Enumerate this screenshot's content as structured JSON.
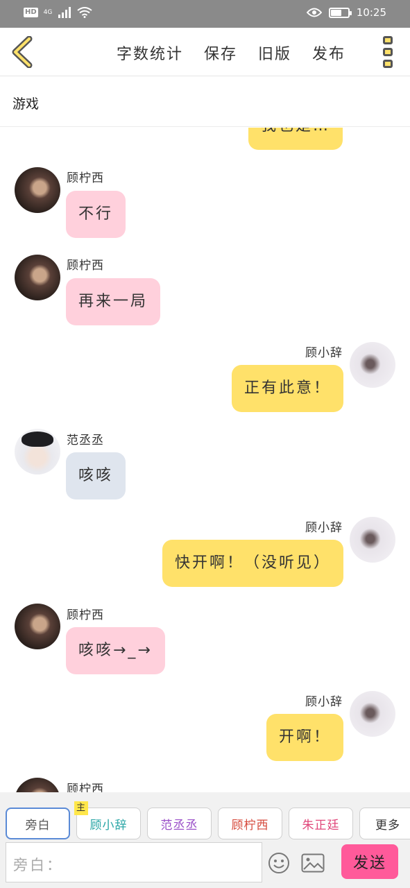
{
  "status_bar": {
    "network_badge": "HD",
    "signal_label": "4G",
    "time": "10:25"
  },
  "toolbar": {
    "actions": [
      "字数统计",
      "保存",
      "旧版",
      "发布"
    ]
  },
  "page": {
    "title": "游戏"
  },
  "messages": [
    {
      "side": "right",
      "speaker": "",
      "text": "我也是…",
      "color": "#ffe16a"
    },
    {
      "side": "left",
      "speaker": "顾柠西",
      "text": "不行",
      "color": "#ffd0dc"
    },
    {
      "side": "left",
      "speaker": "顾柠西",
      "text": "再来一局",
      "color": "#ffd0dc"
    },
    {
      "side": "right",
      "speaker": "顾小辞",
      "text": "正有此意！",
      "color": "#ffe16a"
    },
    {
      "side": "left",
      "speaker": "范丞丞",
      "text": "咳咳",
      "color": "#dfe5ee"
    },
    {
      "side": "right",
      "speaker": "顾小辞",
      "text": "快开啊！（没听见）",
      "color": "#ffe16a"
    },
    {
      "side": "left",
      "speaker": "顾柠西",
      "text": "咳咳→_→",
      "color": "#ffd0dc"
    },
    {
      "side": "right",
      "speaker": "顾小辞",
      "text": "开啊！",
      "color": "#ffe16a"
    },
    {
      "side": "left",
      "speaker": "顾柠西",
      "text": "",
      "color": "#ffd0dc"
    }
  ],
  "roles": [
    {
      "label": "旁白",
      "color": "#555555",
      "active": true
    },
    {
      "label": "顾小辞",
      "color": "#2aa6a6",
      "badge": "主"
    },
    {
      "label": "范丞丞",
      "color": "#9a4fc8"
    },
    {
      "label": "顾柠西",
      "color": "#d64a3c"
    },
    {
      "label": "朱正廷",
      "color": "#e0467a"
    },
    {
      "label": "更多",
      "color": "#333333"
    }
  ],
  "composer": {
    "placeholder": "旁白：",
    "send_label": "发送"
  },
  "icons": {
    "back": "chevron-left-icon",
    "menu": "more-vertical-icon",
    "emoji": "smiley-icon",
    "image": "image-icon"
  }
}
